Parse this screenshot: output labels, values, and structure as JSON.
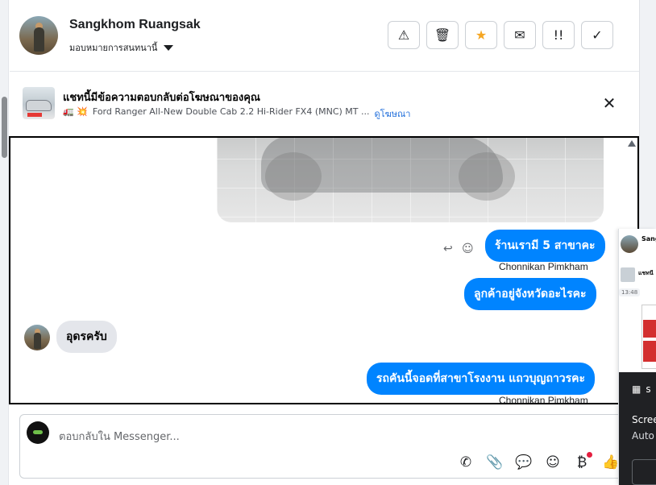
{
  "header": {
    "contact_name": "Sangkhom Ruangsak",
    "assign_label": "มอบหมายการสนทนานี้",
    "actions": [
      {
        "icon": "warning-icon",
        "glyph": "⚠"
      },
      {
        "icon": "trash-icon",
        "glyph": "🗑"
      },
      {
        "icon": "star-icon",
        "glyph": "★"
      },
      {
        "icon": "envelope-open-icon",
        "glyph": "✉"
      },
      {
        "icon": "priority-icon",
        "glyph": "!!"
      },
      {
        "icon": "check-icon",
        "glyph": "✓"
      }
    ]
  },
  "ad_bar": {
    "title": "แชทนี้มีข้อความตอบกลับต่อโฆษณาของคุณ",
    "emoji": "🚛 💥",
    "subtitle": "Ford Ranger All-New Double Cab 2.2 Hi-Rider FX4 (MNC) MT ...",
    "link": "ดูโฆษณา",
    "close_glyph": "✕"
  },
  "messages": [
    {
      "id": "m1",
      "direction": "out",
      "text": "ร้านเรามี 5 สาขาคะ",
      "sender": "Chonnikan Pimkham"
    },
    {
      "id": "m2",
      "direction": "out",
      "text": "ลูกค้าอยู่จังหวัดอะไรคะ"
    },
    {
      "id": "m3",
      "direction": "in",
      "text": "อุดรครับ"
    },
    {
      "id": "m4",
      "direction": "out",
      "text": "รถคันนี้จอดที่สาขาโรงงาน แถวบุญถาวรคะ",
      "sender": "Chonnikan Pimkham"
    }
  ],
  "composer": {
    "placeholder": "ตอบกลับใน Messenger...",
    "tools": [
      {
        "icon": "call-add-icon",
        "glyph": "✆"
      },
      {
        "icon": "attach-icon",
        "glyph": "⌕"
      },
      {
        "icon": "chat-bubble-icon",
        "glyph": "💬"
      },
      {
        "icon": "emoji-icon",
        "glyph": "☺"
      },
      {
        "icon": "bitcoin-icon",
        "glyph": "₿"
      },
      {
        "icon": "thumbs-up-icon",
        "glyph": "👍"
      }
    ]
  },
  "peek_panel": {
    "name": "Sangk",
    "snippet": "แชทนี",
    "time": "13:48",
    "notice_glyph": "s",
    "line1": "Scree",
    "line2": "Auto"
  }
}
